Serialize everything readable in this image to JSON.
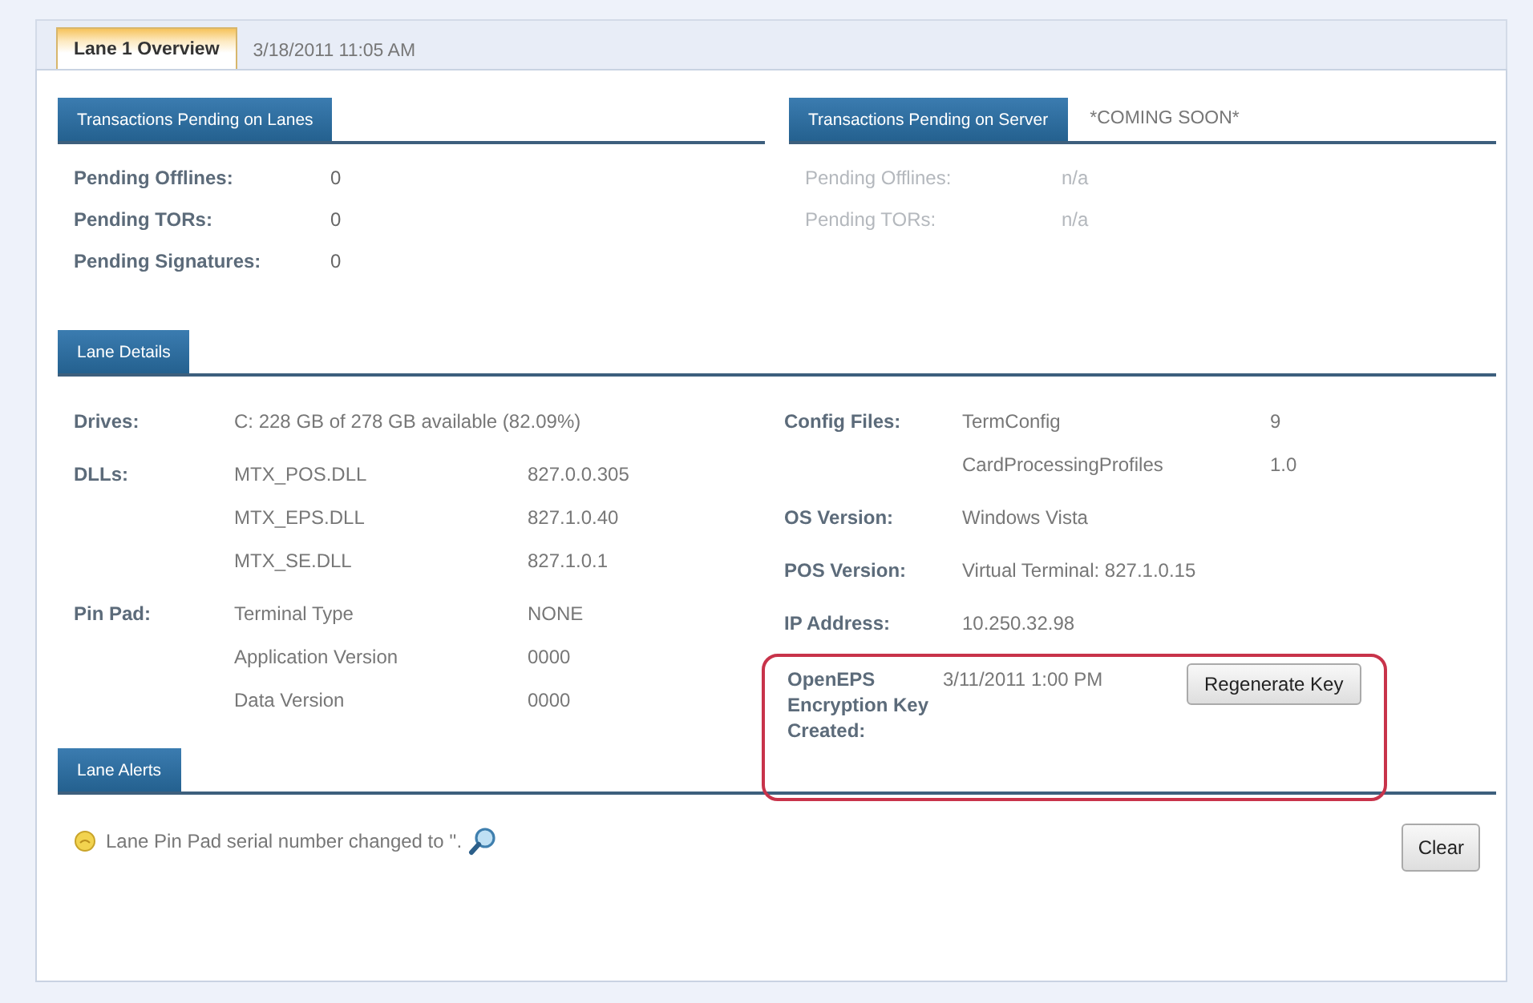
{
  "tabs": [
    {
      "label": "Lane 1 Overview",
      "selected": true
    },
    {
      "label": "3/18/2011 11:05 AM",
      "selected": false
    }
  ],
  "lanes_pending": {
    "header": "Transactions Pending on Lanes",
    "disabled": false,
    "rows": [
      {
        "label": "Pending Offlines:",
        "value": "0"
      },
      {
        "label": "Pending TORs:",
        "value": "0"
      },
      {
        "label": "Pending Signatures:",
        "value": "0"
      }
    ]
  },
  "server_pending": {
    "header": "Transactions Pending on Server",
    "note": "*COMING SOON*",
    "disabled": true,
    "rows": [
      {
        "label": "Pending Offlines:",
        "value": "n/a"
      },
      {
        "label": "Pending TORs:",
        "value": "n/a"
      }
    ]
  },
  "lane_details": {
    "header": "Lane Details",
    "left": [
      {
        "label": "Drives:",
        "entries": [
          {
            "name": "C: 228 GB of 278 GB available (82.09%)"
          }
        ]
      },
      {
        "label": "DLLs:",
        "entries": [
          {
            "name": "MTX_POS.DLL",
            "value": "827.0.0.305"
          },
          {
            "name": "MTX_EPS.DLL",
            "value": "827.1.0.40"
          },
          {
            "name": "MTX_SE.DLL",
            "value": "827.1.0.1"
          }
        ]
      },
      {
        "label": "Pin Pad:",
        "entries": [
          {
            "name": "Terminal Type",
            "value": "NONE"
          },
          {
            "name": "Application Version",
            "value": "0000"
          },
          {
            "name": "Data Version",
            "value": "0000"
          }
        ]
      }
    ],
    "right": [
      {
        "label": "Config Files:",
        "entries": [
          {
            "name": "TermConfig",
            "value": "9"
          },
          {
            "name": "CardProcessingProfiles",
            "value": "1.0"
          }
        ]
      },
      {
        "label": "OS Version:",
        "entries": [
          {
            "name": "Windows Vista"
          }
        ]
      },
      {
        "label": "POS Version:",
        "entries": [
          {
            "name": "Virtual Terminal: 827.1.0.15"
          }
        ]
      },
      {
        "label": "IP Address:",
        "entries": [
          {
            "name": "10.250.32.98"
          }
        ]
      }
    ],
    "key": {
      "label": "OpenEPS Encryption Key Created:",
      "value": "3/11/2011 1:00 PM",
      "button": "Regenerate Key",
      "highlighted": true
    }
  },
  "lane_alerts": {
    "header": "Lane Alerts",
    "alerts": [
      {
        "text": "Lane Pin Pad serial number changed to ''."
      }
    ],
    "button": "Clear"
  }
}
